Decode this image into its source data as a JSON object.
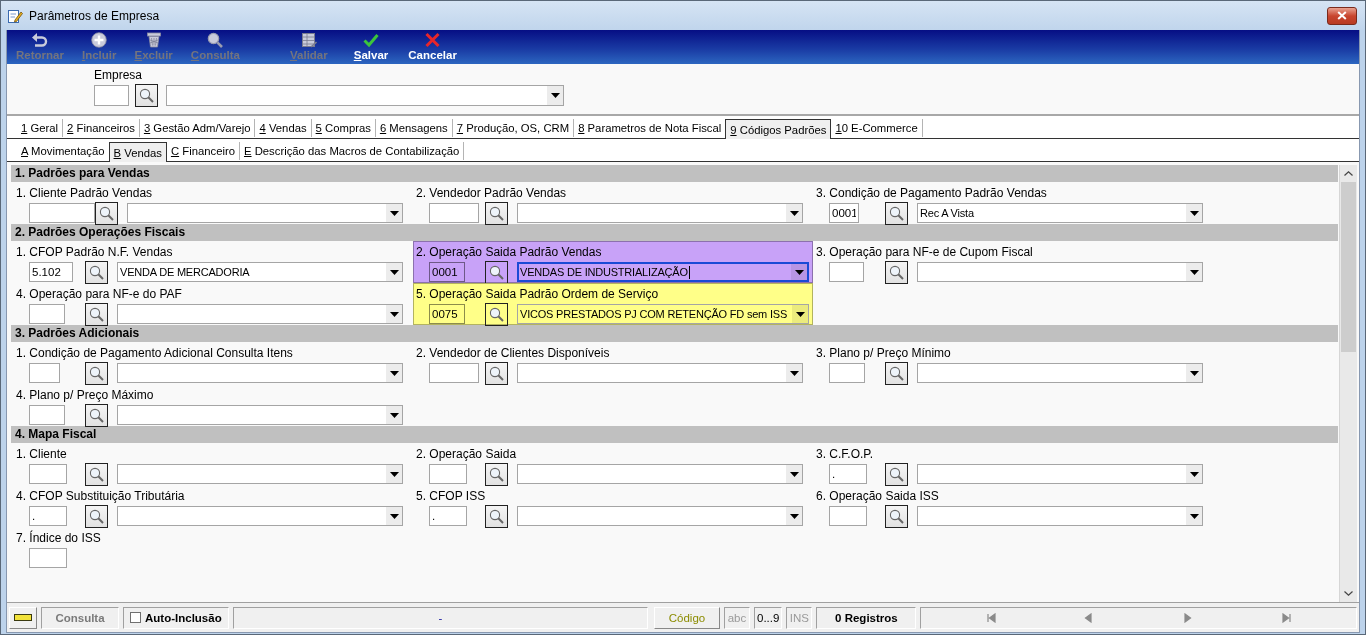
{
  "window": {
    "title": "Parâmetros de Empresa"
  },
  "toolbar": [
    {
      "label": "Retornar",
      "kind": "undo",
      "disabled": true,
      "mnemonic": false
    },
    {
      "label": "Incluir",
      "kind": "add",
      "disabled": true,
      "mnemonic": true
    },
    {
      "label": "Excluir",
      "kind": "delete",
      "disabled": true,
      "mnemonic": true
    },
    {
      "label": "Consulta",
      "kind": "search",
      "disabled": true,
      "mnemonic": true
    },
    {
      "label": "Validar",
      "kind": "validate",
      "disabled": true,
      "mnemonic": true
    },
    {
      "label": "Salvar",
      "kind": "save",
      "disabled": false,
      "mnemonic": true
    },
    {
      "label": "Cancelar",
      "kind": "cancel",
      "disabled": false,
      "mnemonic": false
    }
  ],
  "company": {
    "label": "Empresa"
  },
  "tabs": [
    {
      "label": "1 Geral",
      "selected": false
    },
    {
      "label": "2 Financeiros",
      "selected": false
    },
    {
      "label": "3 Gestão Adm/Varejo",
      "selected": false
    },
    {
      "label": "4 Vendas",
      "selected": false
    },
    {
      "label": "5 Compras",
      "selected": false
    },
    {
      "label": "6 Mensagens",
      "selected": false
    },
    {
      "label": "7 Produção, OS, CRM",
      "selected": false
    },
    {
      "label": "8 Parametros de Nota Fiscal",
      "selected": false
    },
    {
      "label": "9 Códigos Padrões",
      "selected": true
    },
    {
      "label": "10 E-Commerce",
      "selected": false
    }
  ],
  "subtabs": [
    {
      "label": "A Movimentação",
      "selected": false
    },
    {
      "label": "B Vendas",
      "selected": true
    },
    {
      "label": "C Financeiro",
      "selected": false
    },
    {
      "label": "E Descrição das Macros de Contabilização",
      "selected": false
    }
  ],
  "sections": [
    {
      "title": "1. Padrões para Vendas",
      "fields": [
        {
          "kind": "lookup",
          "label": "1. Cliente Padrão Vendas"
        },
        {
          "kind": "lookup",
          "label": "2. Vendedor Padrão Vendas"
        },
        {
          "kind": "lookup",
          "label": "3. Condição de Pagamento Padrão Vendas",
          "code": "0001",
          "value": "Rec A Vista"
        }
      ]
    },
    {
      "title": "2. Padrões Operações Fiscais",
      "fields": [
        {
          "kind": "lookup",
          "label": "1. CFOP Padrão N.F. Vendas",
          "code": "5.102",
          "value": "VENDA DE MERCADORIA"
        },
        {
          "kind": "lookup",
          "label": "2. Operação Saida Padrão Vendas",
          "code": "0001",
          "value": "VENDAS DE INDUSTRIALIZAÇÃO",
          "focused": true,
          "color": "#c8a2f8"
        },
        {
          "kind": "lookup",
          "label": "3. Operação para NF-e de Cupom Fiscal"
        },
        {
          "kind": "lookup",
          "label": "4. Operação para NF-e do PAF"
        },
        {
          "kind": "lookup",
          "label": "5. Operação Saida Padrão Ordem de Serviço",
          "code": "0075",
          "value": "VICOS PRESTADOS PJ COM RETENÇÃO FD sem ISS",
          "color": "#ffff88"
        }
      ]
    },
    {
      "title": "3. Padrões Adicionais",
      "fields": [
        {
          "kind": "lookup",
          "label": "1. Condição de Pagamento Adicional Consulta Itens"
        },
        {
          "kind": "lookup",
          "label": "2. Vendedor de Clientes Disponíveis"
        },
        {
          "kind": "lookup",
          "label": "3. Plano p/ Preço Mínimo"
        },
        {
          "kind": "lookup",
          "label": "4. Plano p/ Preço Máximo"
        }
      ]
    },
    {
      "title": "4. Mapa Fiscal",
      "fields": [
        {
          "kind": "lookup",
          "label": "1. Cliente"
        },
        {
          "kind": "lookup",
          "label": "2. Operação Saida"
        },
        {
          "kind": "lookup",
          "label": "3. C.F.O.P.",
          "code": "."
        },
        {
          "kind": "lookup",
          "label": "4. CFOP Substituição Tributária",
          "code": "."
        },
        {
          "kind": "lookup",
          "label": "5. CFOP ISS",
          "code": "."
        },
        {
          "kind": "lookup",
          "label": "6. Operação Saida ISS"
        },
        {
          "kind": "code",
          "label": "7. Índice do ISS"
        }
      ]
    }
  ],
  "status_bar": {
    "mode": "Consulta",
    "auto_inclusion": {
      "label": "Auto-Inclusão",
      "checked": false
    },
    "message": "-",
    "key_button": "Código",
    "indicators": [
      {
        "label": "abc",
        "active": false
      },
      {
        "label": "0...9",
        "active": true
      },
      {
        "label": "INS",
        "active": false
      }
    ],
    "records": "0 Registros"
  }
}
